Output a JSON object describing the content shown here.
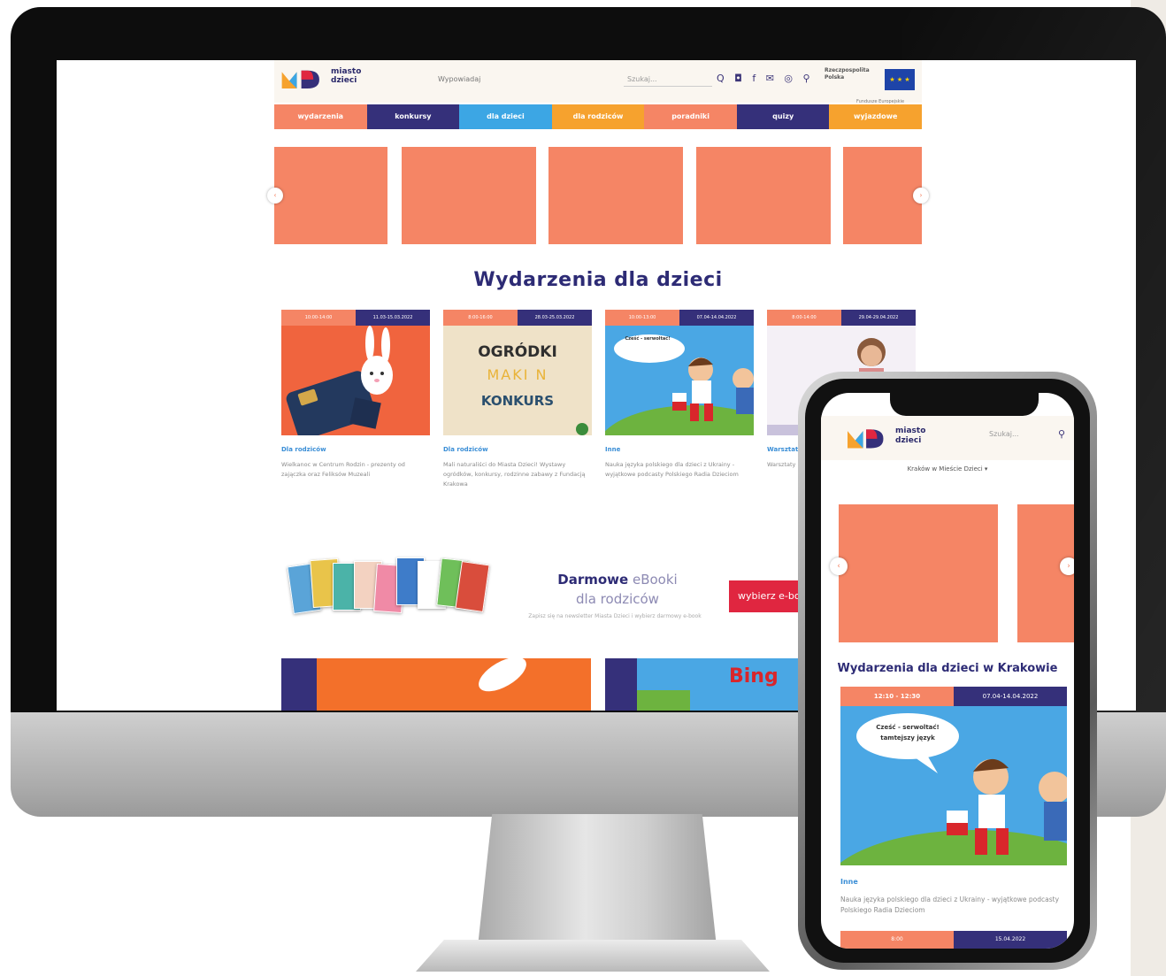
{
  "desktop": {
    "logo": {
      "line1": "miasto",
      "line2": "dzieci"
    },
    "tagline": "Wypowiadaj",
    "search_placeholder": "Szukaj...",
    "header_icons": "Q ◘ f ✉ ◎ ⚲",
    "eu_text": "Rzeczpospolita Polska",
    "eu_flag": "★ ★ ★",
    "eu_sub": "Fundusze Europejskie",
    "nav": [
      {
        "label": "wydarzenia",
        "color": "#f58565"
      },
      {
        "label": "konkursy",
        "color": "#35307a"
      },
      {
        "label": "dla dzieci",
        "color": "#3ca6e4"
      },
      {
        "label": "dla rodziców",
        "color": "#f6a22e"
      },
      {
        "label": "poradniki",
        "color": "#f58565"
      },
      {
        "label": "quizy",
        "color": "#35307a"
      },
      {
        "label": "wyjazdowe",
        "color": "#f6a22e"
      }
    ],
    "slider_prev": "‹",
    "slider_next": "›",
    "section_title": "Wydarzenia dla dzieci",
    "cards": [
      {
        "hours": "10:00-14:00",
        "dates": "11.03-15.03.2022",
        "category": "Dla rodziców",
        "desc": "Wielkanoc w Centrum Rodzin - prezenty od zajączka oraz Feliksów Muzeali"
      },
      {
        "hours": "8:00-16:00",
        "dates": "28.03-25.03.2022",
        "category": "Dla rodziców",
        "desc": "Mali naturaliści do Miasta Dzieci! Wystawy ogródków, konkursy, rodzinne zabawy z Fundacją Krakowa",
        "img_line1": "OGRÓDKI",
        "img_line2": "MAKI N",
        "img_line3": "KONKURS"
      },
      {
        "hours": "10:00-13:00",
        "dates": "07.04-14.04.2022",
        "category": "Inne",
        "desc": "Nauka języka polskiego dla dzieci z Ukrainy - wyjątkowe podcasty Polskiego Radia Dzieciom",
        "bubble": "Cześć - serwoltać!"
      },
      {
        "hours": "8:00-14:00",
        "dates": "29.04-29.04.2022",
        "category": "Warsztaty",
        "desc": "Warsztaty"
      }
    ],
    "ebook": {
      "title_bold": "Darmowe",
      "title_rest": " eBooki",
      "title_line2": "dla rodziców",
      "sub": "Zapisz się na newsletter Miasta Dzieci i wybierz darmowy e-book",
      "button": "wybierz e-book"
    },
    "promo_bing": "Bing"
  },
  "phone": {
    "logo": {
      "line1": "miasto",
      "line2": "dzieci"
    },
    "search_placeholder": "Szukaj...",
    "search_icon": "⚲",
    "welcome": "Kraków w Mieście Dzieci ▾",
    "slider_prev": "‹",
    "slider_next": "›",
    "section_title": "Wydarzenia dla dzieci w Krakowie",
    "card": {
      "hours": "12:10 - 12:30",
      "dates": "07.04-14.04.2022",
      "category": "Inne",
      "desc": "Nauka języka polskiego dla dzieci z Ukrainy - wyjątkowe podcasty Polskiego Radia Dzieciom",
      "bubble": "Cześć - serwoltać! tamtejszy język"
    },
    "card2": {
      "hours": "8:00",
      "dates": "15.04.2022"
    }
  },
  "colors": {
    "coral": "#f58565",
    "navy": "#35307a",
    "sky": "#3ca6e4",
    "amber": "#f6a22e",
    "red": "#e02640"
  }
}
